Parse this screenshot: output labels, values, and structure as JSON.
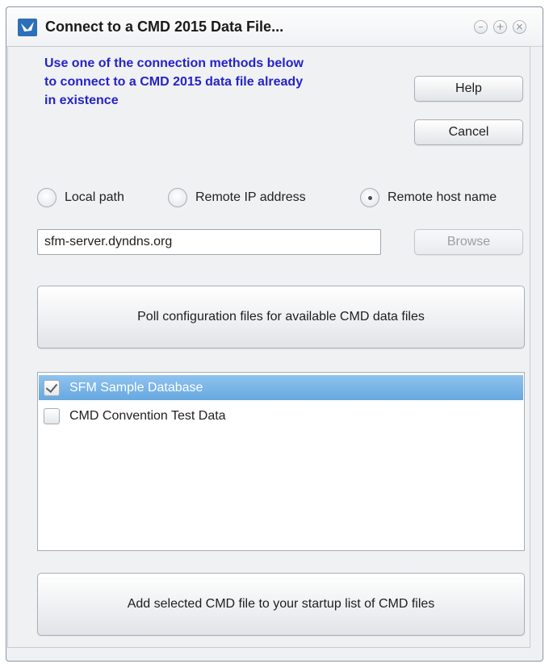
{
  "window": {
    "title": "Connect to a CMD 2015 Data File...",
    "controls": [
      "minimize",
      "maximize",
      "close"
    ]
  },
  "intro_text": "Use one of the connection methods below to connect to a CMD 2015 data file already in existence",
  "buttons": {
    "help": "Help",
    "cancel": "Cancel",
    "browse": "Browse",
    "poll": "Poll configuration files for available CMD data files",
    "add": "Add selected CMD file to your startup list of CMD files"
  },
  "connection_methods": [
    {
      "label": "Local path",
      "selected": false
    },
    {
      "label": "Remote IP address",
      "selected": false
    },
    {
      "label": "Remote host name",
      "selected": true
    }
  ],
  "address_field": {
    "value": "sfm-server.dyndns.org"
  },
  "data_files": [
    {
      "label": "SFM Sample Database",
      "checked": true,
      "selected": true
    },
    {
      "label": "CMD Convention Test Data",
      "checked": false,
      "selected": false
    }
  ],
  "colors": {
    "intro_text": "#2424c8",
    "selection": "#66a8e0",
    "window_bg": "#f0f1f3"
  }
}
